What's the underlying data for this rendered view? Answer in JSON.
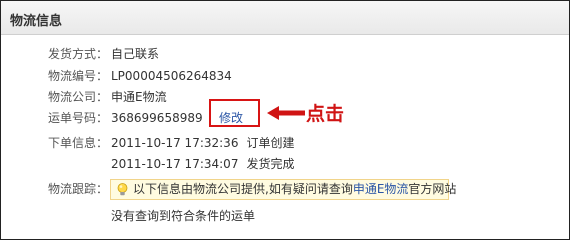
{
  "panel": {
    "title": "物流信息"
  },
  "fields": {
    "ship_method": {
      "label": "发货方式：",
      "value": "自己联系"
    },
    "logistics_no": {
      "label": "物流编号：",
      "value": "LP00004506264834"
    },
    "carrier": {
      "label": "物流公司：",
      "value": "申通E物流"
    },
    "waybill": {
      "label": "运单号码：",
      "value": "368699658989",
      "edit_label": "修改"
    },
    "order_info": {
      "label": "下单信息：",
      "entries": [
        {
          "time": "2011-10-17 17:32:36",
          "status": "订单创建"
        },
        {
          "time": "2011-10-17 17:34:07",
          "status": "发货完成"
        }
      ]
    },
    "tracking": {
      "label": "物流跟踪：",
      "tip_prefix": "以下信息由物流公司提供,如有疑问请查询",
      "tip_link": "申通E物流",
      "tip_suffix": "官方网站",
      "no_result": "没有查询到符合条件的运单"
    }
  },
  "annotation": {
    "text": "点击",
    "color": "#d01414"
  },
  "colors": {
    "link": "#2b56a6",
    "highlight_border": "#d81414",
    "tip_background": "#fffbe0",
    "tip_border": "#f1d48a"
  },
  "icons": {
    "tip": "lightbulb-icon",
    "pointer": "left-arrow-icon"
  }
}
